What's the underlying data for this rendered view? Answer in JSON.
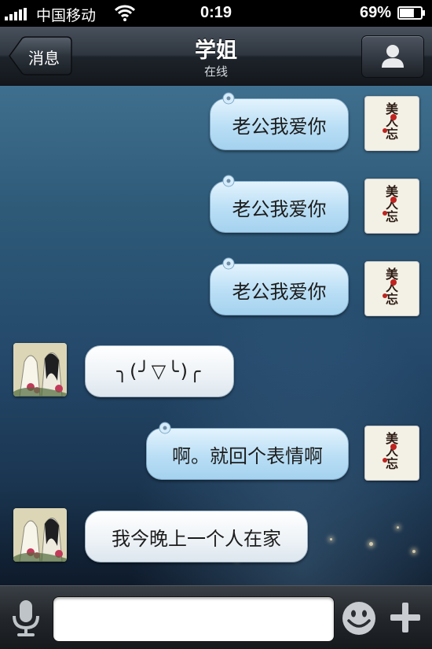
{
  "status_bar": {
    "carrier": "中国移动",
    "time": "0:19",
    "battery": "69%",
    "battery_level": 0.69
  },
  "nav": {
    "back_label": "消息",
    "title": "学姐",
    "subtitle": "在线"
  },
  "messages": [
    {
      "side": "out",
      "text": "老公我爱你"
    },
    {
      "side": "out",
      "text": "老公我爱你"
    },
    {
      "side": "out",
      "text": "老公我爱你"
    },
    {
      "side": "in",
      "text": "╮(╯▽╰)╭"
    },
    {
      "side": "out",
      "text": "啊。就回个表情啊"
    },
    {
      "side": "in",
      "text": "我今晚上一个人在家"
    }
  ],
  "avatar_text": "美人忘",
  "input": {
    "value": ""
  },
  "icons": {
    "voice": "microphone-icon",
    "emoji": "smiley-icon",
    "more": "plus-icon",
    "profile": "person-icon",
    "wifi": "wifi-icon",
    "battery": "battery-icon"
  },
  "colors": {
    "outgoing_bubble": "#b9def5",
    "incoming_bubble": "#eef3f7",
    "nav_bar": "#2f363f"
  }
}
